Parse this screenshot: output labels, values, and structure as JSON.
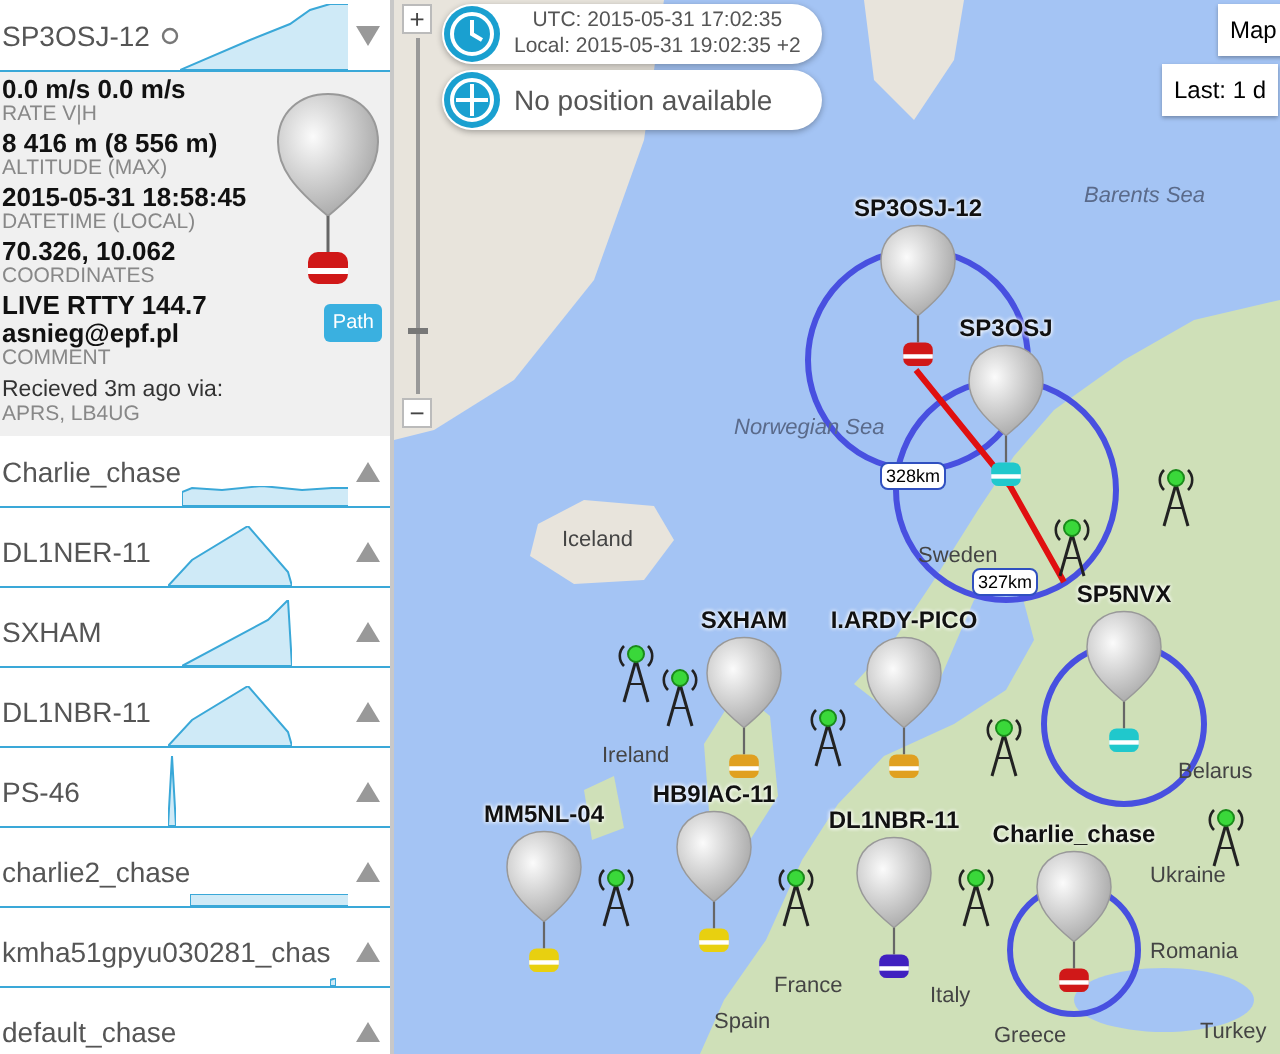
{
  "sidebar": {
    "items": [
      {
        "name": "SP3OSJ-12",
        "expanded": true,
        "details": {
          "fields": [
            {
              "value": [
                "0.0 m/s 0.0 m/s"
              ],
              "label": "RATE V|H"
            },
            {
              "value": [
                "8 416 m (8 556 m)"
              ],
              "label": "ALTITUDE (MAX)"
            },
            {
              "value": [
                "2015-05-31 18:58:45"
              ],
              "label": "DATETIME (LOCAL)"
            },
            {
              "value": [
                "70.326, 10.062"
              ],
              "label": "COORDINATES"
            },
            {
              "value": [
                "LIVE RTTY 144.7",
                "asnieg@epf.pl"
              ],
              "label": "COMMENT"
            }
          ],
          "received": "Recieved 3m ago via:",
          "via": "APRS, LB4UG",
          "path_button": "Path"
        }
      },
      {
        "name": "Charlie_chase",
        "expanded": false
      },
      {
        "name": "DL1NER-11",
        "expanded": false
      },
      {
        "name": "SXHAM",
        "expanded": false
      },
      {
        "name": "DL1NBR-11",
        "expanded": false
      },
      {
        "name": "PS-46",
        "expanded": false
      },
      {
        "name": "charlie2_chase",
        "expanded": false
      },
      {
        "name": "kmha51gpyu030281_chas",
        "expanded": false
      },
      {
        "name": "default_chase",
        "expanded": false
      }
    ]
  },
  "map": {
    "zoom_in": "+",
    "zoom_out": "−",
    "zoom": {
      "level": 0.17
    },
    "clock": {
      "utc": "UTC: 2015-05-31 17:02:35",
      "local": "Local: 2015-05-31 19:02:35 +2"
    },
    "position": "No position available",
    "map_type_button": "Map",
    "range_button": "Last: 1 d",
    "places": [
      "Barents Sea",
      "Norwegian Sea",
      "Iceland",
      "Sweden",
      "Ireland",
      "France",
      "Belarus",
      "Ukraine",
      "Romania",
      "Italy",
      "Spain",
      "Greece",
      "Turkey"
    ],
    "balloons": [
      {
        "label": "SP3OSJ-12",
        "color": "#d01818"
      },
      {
        "label": "SP3OSJ",
        "color": "#20c8cc"
      },
      {
        "label": "SP5NVX",
        "color": "#20c8cc"
      },
      {
        "label": "SXHAM",
        "color": "#e0a020"
      },
      {
        "label": "I.ARDY-PICO",
        "color": "#e0a020"
      },
      {
        "label": "DL1NBR-11",
        "color": "#4020c0"
      },
      {
        "label": "HB9IAC-11",
        "color": "#e8d010"
      },
      {
        "label": "MM5NL-04",
        "color": "#e8d010"
      },
      {
        "label": "Charlie_chase",
        "color": "#d01818"
      }
    ],
    "distances": [
      "328km",
      "327km"
    ]
  }
}
